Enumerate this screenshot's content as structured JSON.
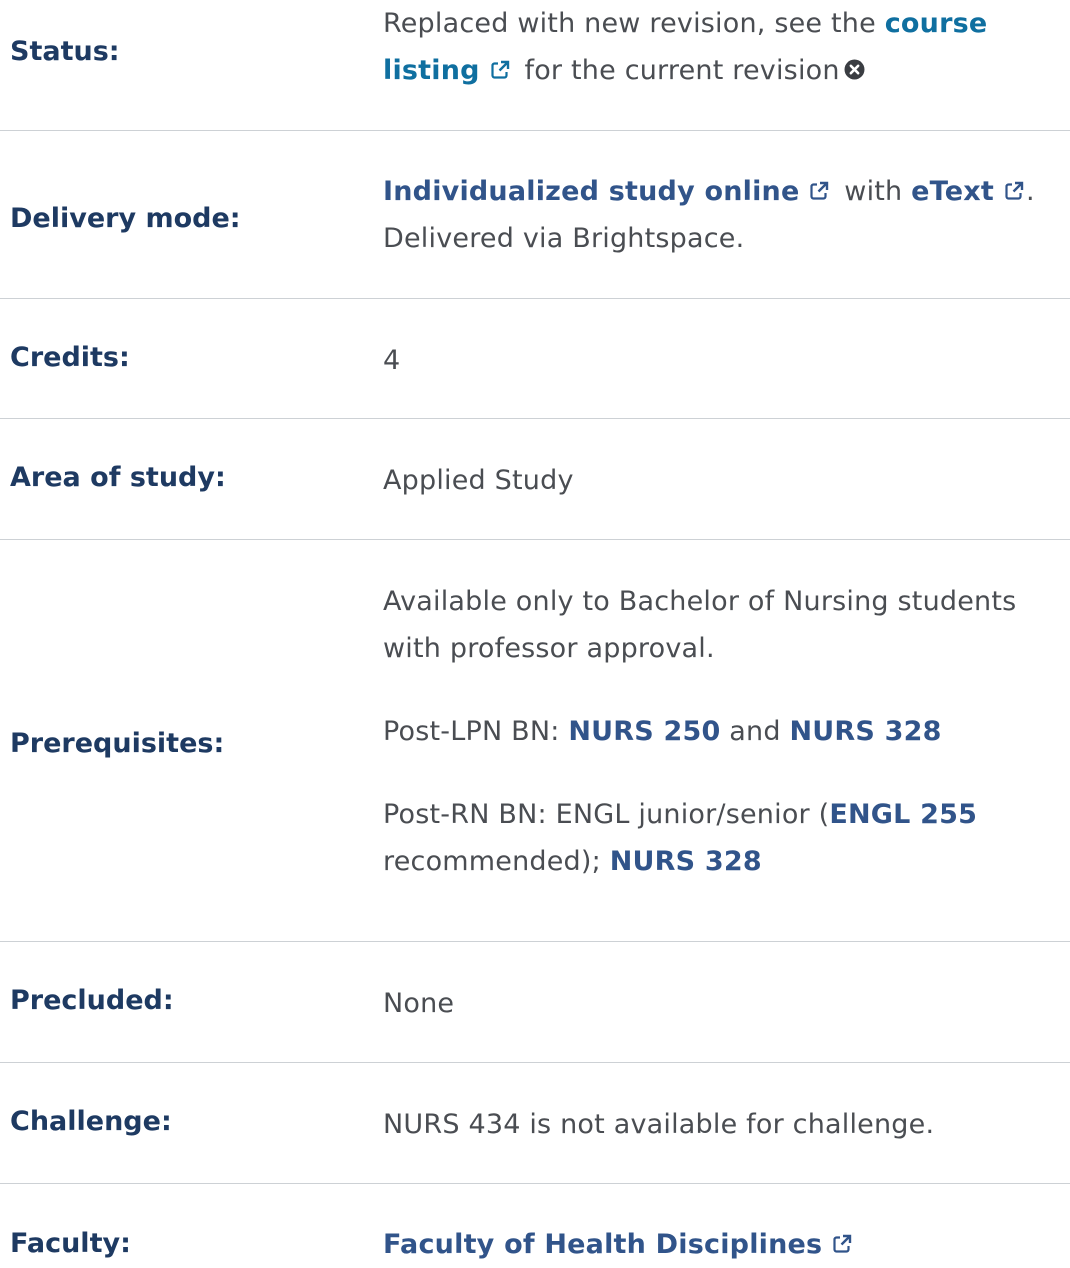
{
  "status": {
    "label": "Status:",
    "text_before": "Replaced with new revision, see the",
    "link": "course listing",
    "text_after": "for the current revision",
    "icons": [
      "external-link-icon",
      "circle-x-icon"
    ]
  },
  "delivery": {
    "label": "Delivery mode:",
    "link1": "Individualized study online",
    "with": "with",
    "link2": "eText",
    "after": ".",
    "line2": "Delivered via Brightspace."
  },
  "credits": {
    "label": "Credits:",
    "value": "4"
  },
  "area": {
    "label": "Area of study:",
    "value": "Applied Study"
  },
  "prerequisites": {
    "label": "Prerequisites:",
    "p1": "Available only to Bachelor of Nursing students with professor approval.",
    "p2_prefix": "Post-LPN BN:",
    "p2_course1": "NURS 250",
    "p2_and": "and",
    "p2_course2": "NURS 328",
    "p3_prefix": "Post-RN BN: ENGL junior/senior (",
    "p3_course1": "ENGL 255",
    "p3_mid": "recommended);",
    "p3_course2": "NURS 328"
  },
  "precluded": {
    "label": "Precluded:",
    "value": "None"
  },
  "challenge": {
    "label": "Challenge:",
    "value": "NURS 434 is not available for challenge."
  },
  "faculty": {
    "label": "Faculty:",
    "link": "Faculty of Health Disciplines"
  },
  "colors": {
    "label": "#1e3a62",
    "link": "#0f6fa0",
    "course_link": "#31548a",
    "text": "#4a4d52",
    "divider": "#cdd1d5"
  }
}
